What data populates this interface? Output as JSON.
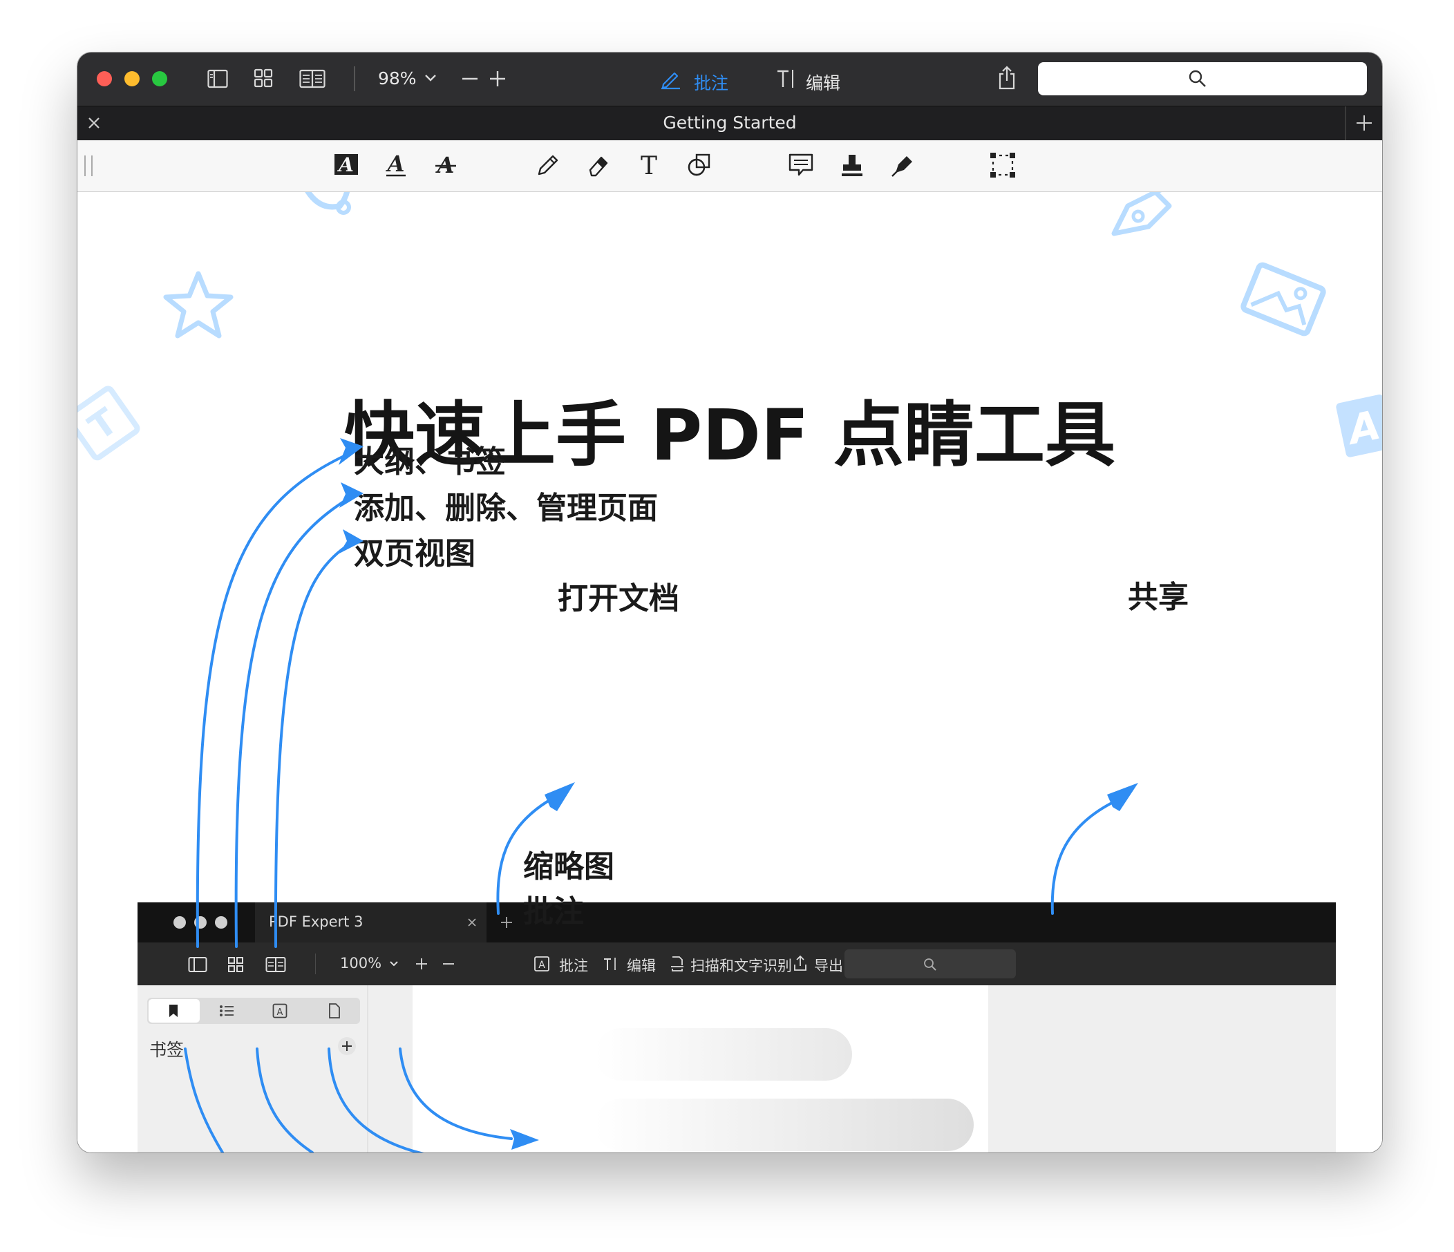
{
  "toolbar": {
    "zoom": "98%",
    "annotate_label": "批注",
    "edit_label": "编辑",
    "search_placeholder": ""
  },
  "tab": {
    "title": "Getting Started"
  },
  "page": {
    "heading": "快速上手 PDF 点睛工具",
    "callouts": {
      "outline": "大纲、书签",
      "pages": "添加、删除、管理页面",
      "two_page": "双页视图",
      "open": "打开文档",
      "share": "共享",
      "thumbnails": "缩略图",
      "annotations": "批注"
    }
  },
  "mock": {
    "tab_title": "PDF Expert 3",
    "zoom": "100%",
    "annotate": "批注",
    "edit": "编辑",
    "scan": "扫描和文字识别",
    "export": "导出",
    "sidebar_title": "书签"
  },
  "colors": {
    "accent": "#2f8df3",
    "decor": "#b8dcff"
  }
}
